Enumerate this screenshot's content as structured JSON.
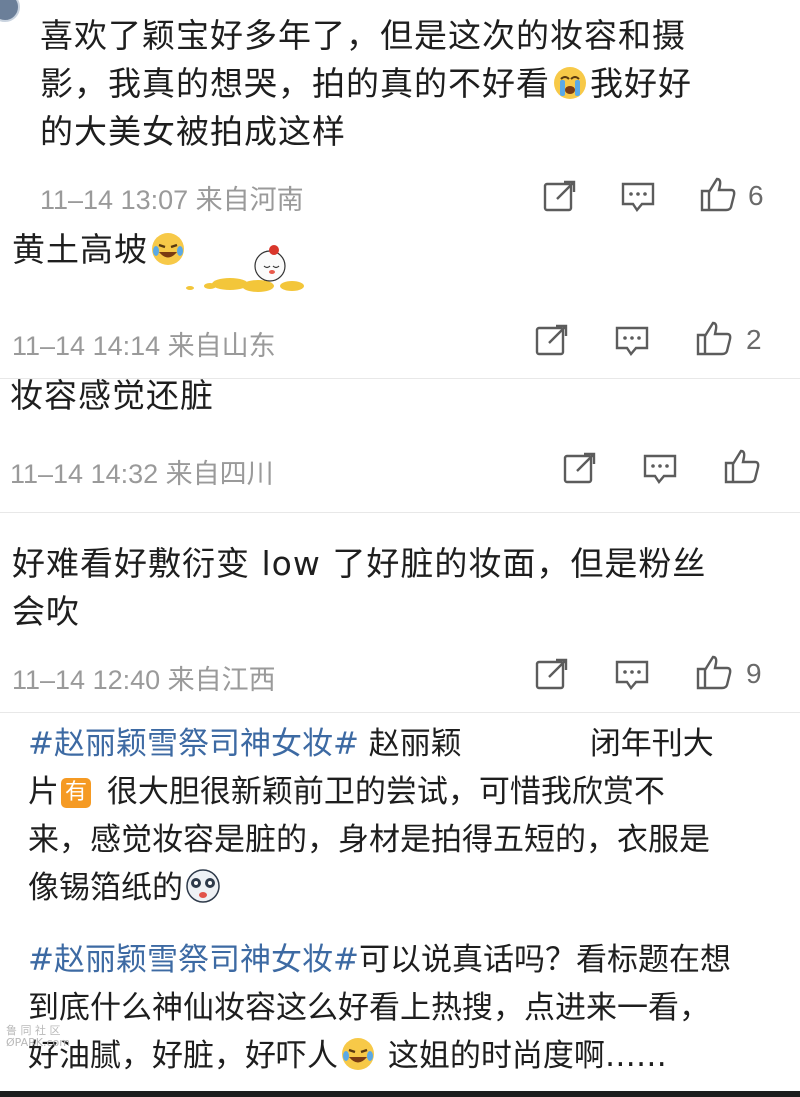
{
  "comments": [
    {
      "lines": [
        "喜欢了颖宝好多年了，但是这次的妆容和摄",
        "影，我真的想哭，拍的真的不好看",
        "我好好",
        "的大美女被拍成这样"
      ],
      "time": "11–14 13:07",
      "location": "来自河南",
      "likes": "6"
    },
    {
      "text": "黄土高坡",
      "time": "11–14 14:14",
      "location": "来自山东",
      "likes": "2"
    },
    {
      "text": "妆容感觉还脏",
      "time": "11–14 14:32",
      "location": "来自四川",
      "likes": ""
    },
    {
      "lines": [
        "好难看好敷衍变 low 了好脏的妆面，但是粉丝",
        "会吹"
      ],
      "time": "11–14 12:40",
      "location": "来自江西",
      "likes": "9"
    }
  ],
  "posts": [
    {
      "hashtag": "#赵丽颖雪祭司神女妆#",
      "line1_after_tag": " 赵丽颖",
      "line1_tail": "闭年刊大",
      "line2_head": "片",
      "badge": "有",
      "line2_tail": " 很大胆很新颖前卫的尝试，可惜我欣赏不",
      "line3": "来，感觉妆容是脏的，身材是拍得五短的，衣服是",
      "line4": "像锡箔纸的"
    },
    {
      "hashtag": "#赵丽颖雪祭司神女妆#",
      "line1_after_tag": "可以说真话吗？看标题在想",
      "line2": "到底什么神仙妆容这么好看上热搜，点进来一看，",
      "line3_head": "好油腻，好脏，好吓人",
      "line3_tail": " 这姐的时尚度啊……"
    }
  ],
  "icons": [
    "repost-icon",
    "comment-icon",
    "like-icon"
  ],
  "colors": {
    "hashtag": "#3d6aa3",
    "meta": "#9a9a9a",
    "badge": "#f59a23"
  },
  "watermark": {
    "line1": "鲁 同 社 区",
    "line2": "ØPARK.com"
  }
}
